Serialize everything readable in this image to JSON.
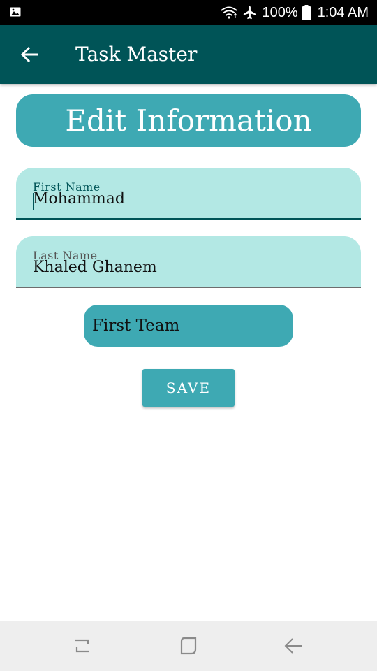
{
  "status_bar": {
    "battery": "100%",
    "time": "1:04 AM",
    "icons": [
      "gallery-icon",
      "wifi-icon",
      "airplane-mode-icon",
      "battery-icon"
    ]
  },
  "app_bar": {
    "title": "Task Master",
    "back_icon": "arrow-left-icon"
  },
  "header": {
    "title": "Edit Information"
  },
  "form": {
    "first_name": {
      "label": "First Name",
      "value": "Mohammad"
    },
    "last_name": {
      "label": "Last Name",
      "value": "Khaled Ghanem"
    },
    "team": {
      "selected": "First Team"
    },
    "save_label": "SAVE"
  },
  "nav_bar": {
    "icons": [
      "recents-icon",
      "home-icon",
      "back-icon"
    ]
  },
  "colors": {
    "app_bar": "#005457",
    "accent": "#3ea9b3",
    "field_background": "#b3e8e4",
    "status_bar": "#000000",
    "nav_bar": "#eeeeee"
  }
}
